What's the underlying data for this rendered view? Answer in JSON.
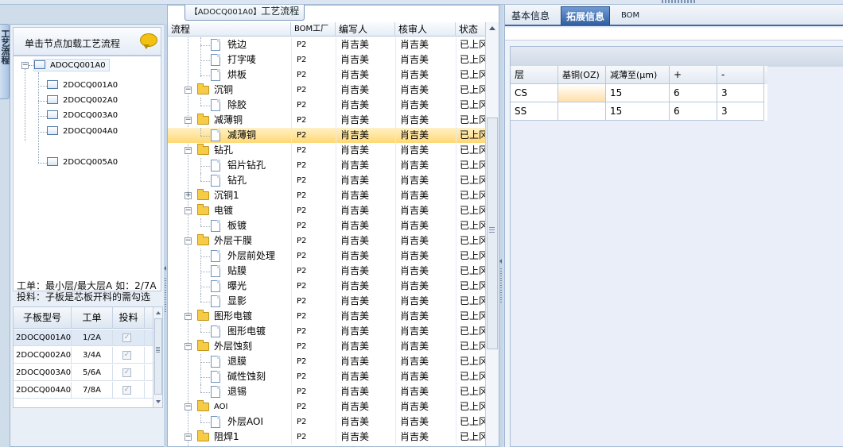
{
  "left_vertical_tab": "工艺流程",
  "left_panel": {
    "header_title": "单击节点加载工艺流程",
    "tree": {
      "root": "ADOCQ001A0",
      "children": [
        "2DOCQ001A0",
        "2DOCQ002A0",
        "2DOCQ003A0",
        "2DOCQ004A0",
        "2DOCQ005A0"
      ]
    },
    "info_line1": "工单：最小层/最大层A 如：2/7A",
    "info_line2": "投料：子板是芯板开料的需勾选",
    "sub_grid": {
      "headers": [
        "子板型号",
        "工单",
        "投料"
      ],
      "rows": [
        {
          "model": "2DOCQ001A0",
          "order": "1/2A",
          "feed": "✓"
        },
        {
          "model": "2DOCQ002A0",
          "order": "3/4A",
          "feed": "✓"
        },
        {
          "model": "2DOCQ003A0",
          "order": "5/6A",
          "feed": "✓"
        },
        {
          "model": "2DOCQ004A0",
          "order": "7/8A",
          "feed": "✓"
        }
      ]
    }
  },
  "mid_panel": {
    "tab_title_code": "【ADOCQ001A0】",
    "tab_title_text": "工艺流程",
    "headers": [
      "流程",
      "BOM工厂",
      "编写人",
      "核审人",
      "状态"
    ],
    "rows": [
      {
        "label": "铣边",
        "bom": "P2",
        "author": "肖吉美",
        "reviewer": "肖吉美",
        "status": "已上冈"
      },
      {
        "label": "打字唛",
        "bom": "P2",
        "author": "肖吉美",
        "reviewer": "肖吉美",
        "status": "已上冈"
      },
      {
        "label": "烘板",
        "bom": "P2",
        "author": "肖吉美",
        "reviewer": "肖吉美",
        "status": "已上冈"
      },
      {
        "label": "沉铜",
        "bom": "P2",
        "author": "肖吉美",
        "reviewer": "肖吉美",
        "status": "已上冈"
      },
      {
        "label": "除胶",
        "bom": "P2",
        "author": "肖吉美",
        "reviewer": "肖吉美",
        "status": "已上冈"
      },
      {
        "label": "减薄铜",
        "bom": "P2",
        "author": "肖吉美",
        "reviewer": "肖吉美",
        "status": "已上冈"
      },
      {
        "label": "减薄铜",
        "bom": "P2",
        "author": "肖吉美",
        "reviewer": "肖吉美",
        "status": "已上冈"
      },
      {
        "label": "钻孔",
        "bom": "P2",
        "author": "肖吉美",
        "reviewer": "肖吉美",
        "status": "已上冈"
      },
      {
        "label": "铝片钻孔",
        "bom": "P2",
        "author": "肖吉美",
        "reviewer": "肖吉美",
        "status": "已上冈"
      },
      {
        "label": "钻孔",
        "bom": "P2",
        "author": "肖吉美",
        "reviewer": "肖吉美",
        "status": "已上冈"
      },
      {
        "label": "沉铜1",
        "bom": "P2",
        "author": "肖吉美",
        "reviewer": "肖吉美",
        "status": "已上冈"
      },
      {
        "label": "电镀",
        "bom": "P2",
        "author": "肖吉美",
        "reviewer": "肖吉美",
        "status": "已上冈"
      },
      {
        "label": "板镀",
        "bom": "P2",
        "author": "肖吉美",
        "reviewer": "肖吉美",
        "status": "已上冈"
      },
      {
        "label": "外层干膜",
        "bom": "P2",
        "author": "肖吉美",
        "reviewer": "肖吉美",
        "status": "已上冈"
      },
      {
        "label": "外层前处理",
        "bom": "P2",
        "author": "肖吉美",
        "reviewer": "肖吉美",
        "status": "已上冈"
      },
      {
        "label": "贴膜",
        "bom": "P2",
        "author": "肖吉美",
        "reviewer": "肖吉美",
        "status": "已上冈"
      },
      {
        "label": "曝光",
        "bom": "P2",
        "author": "肖吉美",
        "reviewer": "肖吉美",
        "status": "已上冈"
      },
      {
        "label": "显影",
        "bom": "P2",
        "author": "肖吉美",
        "reviewer": "肖吉美",
        "status": "已上冈"
      },
      {
        "label": "图形电镀",
        "bom": "P2",
        "author": "肖吉美",
        "reviewer": "肖吉美",
        "status": "已上冈"
      },
      {
        "label": "图形电镀",
        "bom": "P2",
        "author": "肖吉美",
        "reviewer": "肖吉美",
        "status": "已上冈"
      },
      {
        "label": "外层蚀刻",
        "bom": "P2",
        "author": "肖吉美",
        "reviewer": "肖吉美",
        "status": "已上冈"
      },
      {
        "label": "退膜",
        "bom": "P2",
        "author": "肖吉美",
        "reviewer": "肖吉美",
        "status": "已上冈"
      },
      {
        "label": "碱性蚀刻",
        "bom": "P2",
        "author": "肖吉美",
        "reviewer": "肖吉美",
        "status": "已上冈"
      },
      {
        "label": "退锡",
        "bom": "P2",
        "author": "肖吉美",
        "reviewer": "肖吉美",
        "status": "已上冈"
      },
      {
        "label": "AOI",
        "bom": "P2",
        "author": "肖吉美",
        "reviewer": "肖吉美",
        "status": "已上冈"
      },
      {
        "label": "外层AOI",
        "bom": "P2",
        "author": "肖吉美",
        "reviewer": "肖吉美",
        "status": "已上冈"
      },
      {
        "label": "阻焊1",
        "bom": "P2",
        "author": "肖吉美",
        "reviewer": "肖吉美",
        "status": "已上冈"
      }
    ]
  },
  "right_panel": {
    "tabs": [
      "基本信息",
      "拓展信息",
      "BOM"
    ],
    "active_tab": "拓展信息",
    "layer_table": {
      "headers": [
        "层",
        "基铜(OZ)",
        "减薄至(μm)",
        "+",
        "-"
      ],
      "rows": [
        {
          "layer": "CS",
          "base": "",
          "thin": "15",
          "plus": "6",
          "minus": "3"
        },
        {
          "layer": "SS",
          "base": "",
          "thin": "15",
          "plus": "6",
          "minus": "3"
        }
      ]
    }
  },
  "colors": {
    "accent": "#2f5f9f",
    "selection": "#ffd875",
    "panel_bg": "#e9eff7"
  }
}
